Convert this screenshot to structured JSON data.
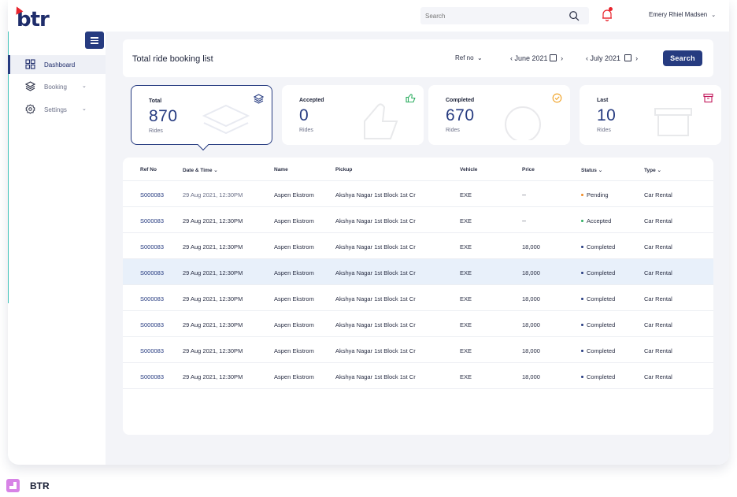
{
  "app": {
    "logo_text": "btr",
    "brand_name": "BTR"
  },
  "header": {
    "search_placeholder": "Search",
    "user_name": "Emery Rhiel Madsen"
  },
  "sidebar": {
    "items": [
      {
        "label": "Dashboard",
        "icon": "grid-icon",
        "active": true
      },
      {
        "label": "Booking",
        "icon": "layers-icon",
        "has_chevron": true
      },
      {
        "label": "Settings",
        "icon": "gear-icon",
        "has_chevron": true
      }
    ]
  },
  "toolbar": {
    "title": "Total ride booking list",
    "ref_filter": "Ref no",
    "date_from": "June 2021",
    "date_to": "July 2021",
    "search_label": "Search"
  },
  "stats": [
    {
      "label": "Total",
      "value": "870",
      "unit": "Rides",
      "icon": "layers-icon",
      "color": "#263b80"
    },
    {
      "label": "Accepted",
      "value": "0",
      "unit": "Rides",
      "icon": "thumbs-up-icon",
      "color": "#2fae62"
    },
    {
      "label": "Completed",
      "value": "670",
      "unit": "Rides",
      "icon": "check-circle-icon",
      "color": "#f0a020"
    },
    {
      "label": "Last",
      "value": "10",
      "unit": "Rides",
      "icon": "archive-icon",
      "color": "#c2185b"
    }
  ],
  "table": {
    "columns": [
      "Ref No",
      "Date & Time",
      "Name",
      "Pickup",
      "Vehicle",
      "Price",
      "Status",
      "Type"
    ],
    "rows": [
      {
        "ref": "S000083",
        "datetime": "29 Aug 2021, 12:30PM",
        "name": "Aspen Ekstrom",
        "pickup": "Akshya Nagar 1st Block 1st Cr",
        "vehicle": "EXE",
        "price": "--",
        "status": "Pending",
        "type": "Car Rental"
      },
      {
        "ref": "S000083",
        "datetime": "29 Aug 2021, 12:30PM",
        "name": "Aspen Ekstrom",
        "pickup": "Akshya Nagar 1st Block 1st Cr",
        "vehicle": "EXE",
        "price": "--",
        "status": "Accepted",
        "type": "Car Rental"
      },
      {
        "ref": "S000083",
        "datetime": "29 Aug 2021, 12:30PM",
        "name": "Aspen Ekstrom",
        "pickup": "Akshya Nagar 1st Block 1st Cr",
        "vehicle": "EXE",
        "price": "18,000",
        "status": "Completed",
        "type": "Car Rental"
      },
      {
        "ref": "S000083",
        "datetime": "29 Aug 2021, 12:30PM",
        "name": "Aspen Ekstrom",
        "pickup": "Akshya Nagar 1st Block 1st Cr",
        "vehicle": "EXE",
        "price": "18,000",
        "status": "Completed",
        "type": "Car Rental"
      },
      {
        "ref": "S000083",
        "datetime": "29 Aug 2021, 12:30PM",
        "name": "Aspen Ekstrom",
        "pickup": "Akshya Nagar 1st Block 1st Cr",
        "vehicle": "EXE",
        "price": "18,000",
        "status": "Completed",
        "type": "Car Rental"
      },
      {
        "ref": "S000083",
        "datetime": "29 Aug 2021, 12:30PM",
        "name": "Aspen Ekstrom",
        "pickup": "Akshya Nagar 1st Block 1st Cr",
        "vehicle": "EXE",
        "price": "18,000",
        "status": "Completed",
        "type": "Car Rental"
      },
      {
        "ref": "S000083",
        "datetime": "29 Aug 2021, 12:30PM",
        "name": "Aspen Ekstrom",
        "pickup": "Akshya Nagar 1st Block 1st Cr",
        "vehicle": "EXE",
        "price": "18,000",
        "status": "Completed",
        "type": "Car Rental"
      },
      {
        "ref": "S000083",
        "datetime": "29 Aug 2021, 12:30PM",
        "name": "Aspen Ekstrom",
        "pickup": "Akshya Nagar 1st Block 1st Cr",
        "vehicle": "EXE",
        "price": "18,000",
        "status": "Completed",
        "type": "Car Rental"
      }
    ],
    "status_colors": {
      "Pending": "#f08a24",
      "Accepted": "#2fae62",
      "Completed": "#263b80"
    },
    "highlighted_row": 3
  }
}
